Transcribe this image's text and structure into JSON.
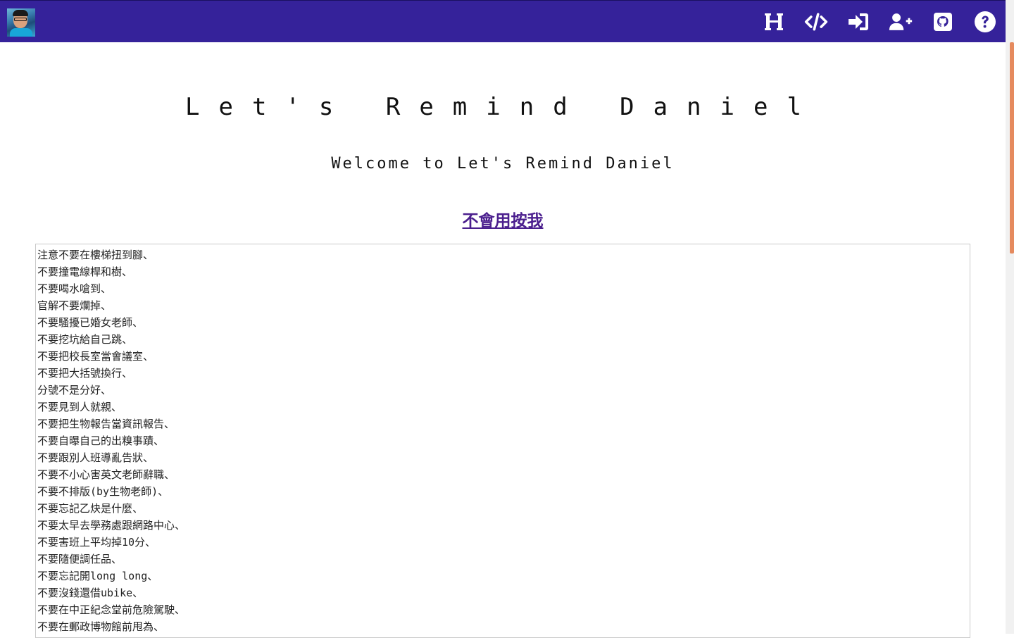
{
  "navbar": {
    "avatar_alt": "Daniel",
    "icons": [
      {
        "name": "heading-icon"
      },
      {
        "name": "code-icon"
      },
      {
        "name": "sign-in-icon"
      },
      {
        "name": "user-plus-icon"
      },
      {
        "name": "github-icon"
      },
      {
        "name": "help-icon"
      }
    ],
    "color": "#35229a"
  },
  "main": {
    "title": "Let's Remind Daniel",
    "subtitle": "Welcome to Let's Remind Daniel",
    "help_link": "不會用按我"
  },
  "reminders": [
    "注意不要在樓梯扭到腳、",
    "不要撞電線桿和樹、",
    "不要喝水嗆到、",
    "官解不要爛掉、",
    "不要騷擾已婚女老師、",
    "不要挖坑給自己跳、",
    "不要把校長室當會議室、",
    "不要把大括號換行、",
    "分號不是分好、",
    "不要見到人就親、",
    "不要把生物報告當資訊報告、",
    "不要自曝自己的出糗事蹟、",
    "不要跟別人班導亂告狀、",
    "不要不小心害英文老師辭職、",
    "不要不排版(by生物老師)、",
    "不要忘記乙炔是什麼、",
    "不要太早去學務處跟網路中心、",
    "不要害班上平均掉10分、",
    "不要隨便調任品、",
    "不要忘記開long long、",
    "不要沒錢還借ubike、",
    "不要在中正紀念堂前危險駕駛、",
    "不要在郵政博物館前甩為、"
  ]
}
